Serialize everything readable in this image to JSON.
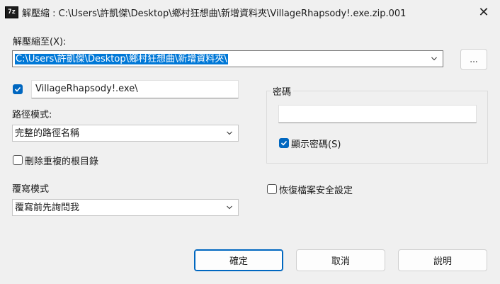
{
  "window": {
    "app_icon_text": "7z",
    "title": "解壓縮 : C:\\Users\\許凱傑\\Desktop\\鄉村狂想曲\\新增資料夾\\VillageRhapsody!.exe.zip.001",
    "close_glyph": "✕"
  },
  "extract_to": {
    "label": "解壓縮至(X):",
    "value": "C:\\Users\\許凱傑\\Desktop\\鄉村狂想曲\\新增資料夾\\",
    "browse_label": "..."
  },
  "subfolder": {
    "checked": true,
    "value": "VillageRhapsody!.exe\\"
  },
  "path_mode": {
    "label": "路徑模式:",
    "value": "完整的路徑名稱"
  },
  "remove_duplicate_root": {
    "label": "刪除重複的根目錄",
    "checked": false
  },
  "overwrite_mode": {
    "label": "覆寫模式",
    "value": "覆寫前先詢問我"
  },
  "password": {
    "group_label": "密碼",
    "value": "",
    "show_label": "顯示密碼(S)",
    "show_checked": true
  },
  "restore_security": {
    "label": "恢復檔案安全設定",
    "checked": false
  },
  "buttons": {
    "ok": "確定",
    "cancel": "取消",
    "help": "說明"
  },
  "colors": {
    "accent": "#0067c0",
    "selection": "#0078d7",
    "background": "#f0f0f0"
  }
}
